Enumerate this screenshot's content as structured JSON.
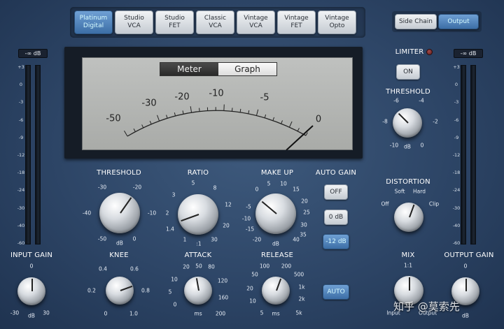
{
  "models": [
    {
      "label": "Platinum\nDigital",
      "active": true
    },
    {
      "label": "Studio\nVCA",
      "active": false
    },
    {
      "label": "Studio\nFET",
      "active": false
    },
    {
      "label": "Classic\nVCA",
      "active": false
    },
    {
      "label": "Vintage\nVCA",
      "active": false
    },
    {
      "label": "Vintage\nFET",
      "active": false
    },
    {
      "label": "Vintage\nOpto",
      "active": false
    }
  ],
  "top_right": {
    "side_chain": "Side Chain",
    "output": "Output"
  },
  "meter_tabs": {
    "meter": "Meter",
    "graph": "Graph"
  },
  "vu_scale": [
    "-50",
    "-30",
    "-20",
    "-10",
    "-5",
    "0"
  ],
  "left_meter": {
    "readout": "-∞ dB",
    "scale": [
      "+3",
      "0",
      "-3",
      "-6",
      "-9",
      "-12",
      "-18",
      "-24",
      "-30",
      "-40",
      "-60"
    ]
  },
  "right_meter": {
    "readout": "-∞ dB",
    "scale": [
      "+3",
      "0",
      "-3",
      "-6",
      "-9",
      "-12",
      "-18",
      "-24",
      "-30",
      "-40",
      "-60"
    ]
  },
  "input_gain": {
    "label": "INPUT GAIN",
    "top": "0",
    "min": "-30",
    "max": "30",
    "unit": "dB"
  },
  "output_gain": {
    "label": "OUTPUT GAIN",
    "top": "0",
    "unit": "dB"
  },
  "threshold": {
    "label": "THRESHOLD",
    "ticks": [
      "-30",
      "-20",
      "-10",
      "0",
      "-50",
      "-40"
    ],
    "unit": "dB"
  },
  "ratio": {
    "label": "RATIO",
    "ticks": [
      "5",
      "8",
      "12",
      "20",
      "30",
      "1.4",
      "2",
      "3"
    ],
    "unit": ":1",
    "one": "1"
  },
  "makeup": {
    "label": "MAKE UP",
    "ticks": [
      "0",
      "5",
      "10",
      "15",
      "20",
      "25",
      "30",
      "35",
      "40",
      "-20",
      "-15",
      "-10",
      "-5"
    ],
    "unit": "dB"
  },
  "auto_gain": {
    "label": "AUTO GAIN",
    "off": "OFF",
    "zero": "0 dB",
    "minus12": "-12 dB"
  },
  "knee": {
    "label": "KNEE",
    "ticks": [
      "0.4",
      "0.6",
      "0.2",
      "0.8",
      "0",
      "1.0"
    ]
  },
  "attack": {
    "label": "ATTACK",
    "ticks": [
      "20",
      "50",
      "80",
      "10",
      "120",
      "5",
      "160",
      "0",
      "200"
    ],
    "unit": "ms"
  },
  "release": {
    "label": "RELEASE",
    "ticks": [
      "100",
      "200",
      "50",
      "500",
      "20",
      "1k",
      "10",
      "2k",
      "5",
      "5k"
    ],
    "unit": "ms"
  },
  "release_auto": "AUTO",
  "limiter": {
    "label": "LIMITER",
    "button": "ON"
  },
  "limiter_threshold": {
    "label": "THRESHOLD",
    "ticks": [
      "-6",
      "-4",
      "-8",
      "-2",
      "-10",
      "0"
    ],
    "unit": "dB"
  },
  "distortion": {
    "label": "DISTORTION",
    "soft": "Soft",
    "hard": "Hard",
    "off": "Off",
    "clip": "Clip"
  },
  "mix": {
    "label": "MIX",
    "ratio": "1:1",
    "input": "Input",
    "output": "Output"
  },
  "watermark": "知乎 @莫索先"
}
